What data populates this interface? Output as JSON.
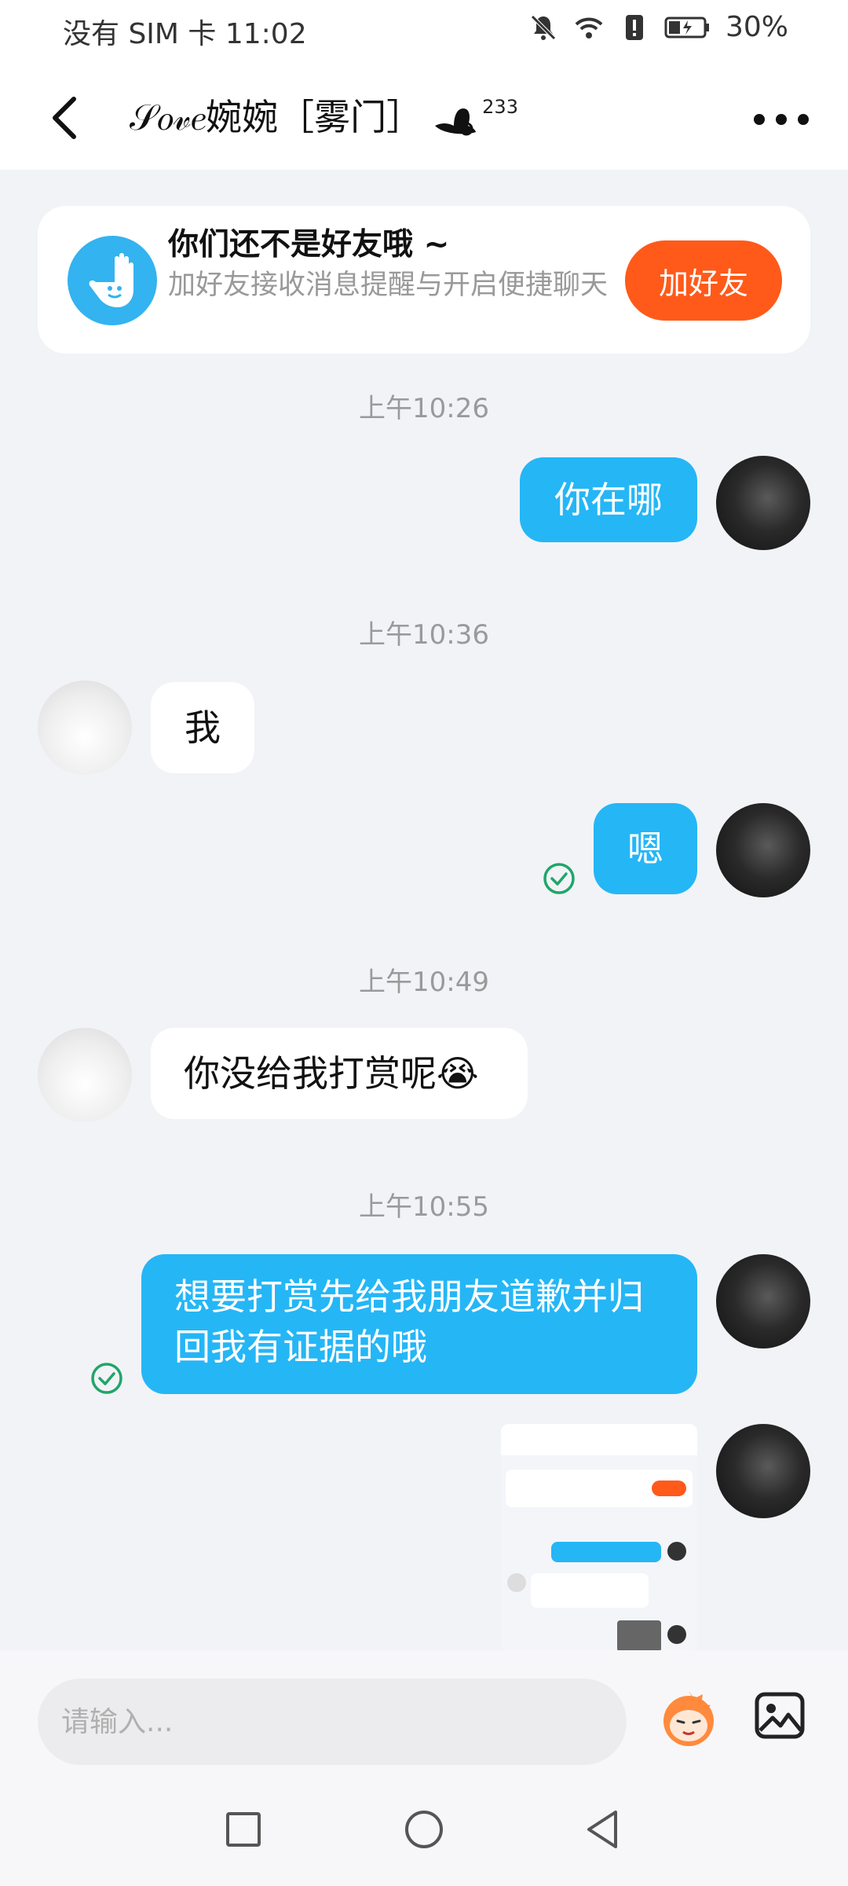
{
  "status_bar": {
    "carrier_time": "没有 SIM 卡 11:02",
    "battery": "30%",
    "icons": [
      "bell-off-icon",
      "wifi-icon",
      "alert-icon",
      "battery-charging-icon"
    ]
  },
  "header": {
    "title": "𝒮𝑜𝓋𝑒婉婉［雾门］",
    "fire_count": "233",
    "back_icon": "back-arrow-icon",
    "more_icon": "more-dots-icon"
  },
  "friend_banner": {
    "title": "你们还不是好友哦 ~",
    "subtitle": "加好友接收消息提醒与开启便捷聊天",
    "button": "加好友",
    "icon": "wave-hand-icon"
  },
  "messages": [
    {
      "type": "time",
      "text": "上午10:26"
    },
    {
      "type": "bubble",
      "from": "me",
      "text": "你在哪"
    },
    {
      "type": "time",
      "text": "上午10:36"
    },
    {
      "type": "bubble",
      "from": "them",
      "text": "我"
    },
    {
      "type": "bubble",
      "from": "me",
      "text": "嗯",
      "read": true
    },
    {
      "type": "time",
      "text": "上午10:49"
    },
    {
      "type": "bubble",
      "from": "them",
      "text": "你没给我打赏呢😭"
    },
    {
      "type": "time",
      "text": "上午10:55"
    },
    {
      "type": "bubble",
      "from": "me",
      "text": "想要打赏先给我朋友道歉并归回我有证据的哦",
      "read": true
    },
    {
      "type": "image",
      "from": "me",
      "description_icon": "screenshot-thumbnail"
    }
  ],
  "input": {
    "placeholder": "请输入..."
  },
  "colors": {
    "accent_blue": "#25b6f6",
    "add_friend_orange": "#ff5a1a",
    "read_check_green": "#1fa66a"
  },
  "nav_icons": [
    "recents-square-icon",
    "home-circle-icon",
    "back-triangle-icon"
  ]
}
